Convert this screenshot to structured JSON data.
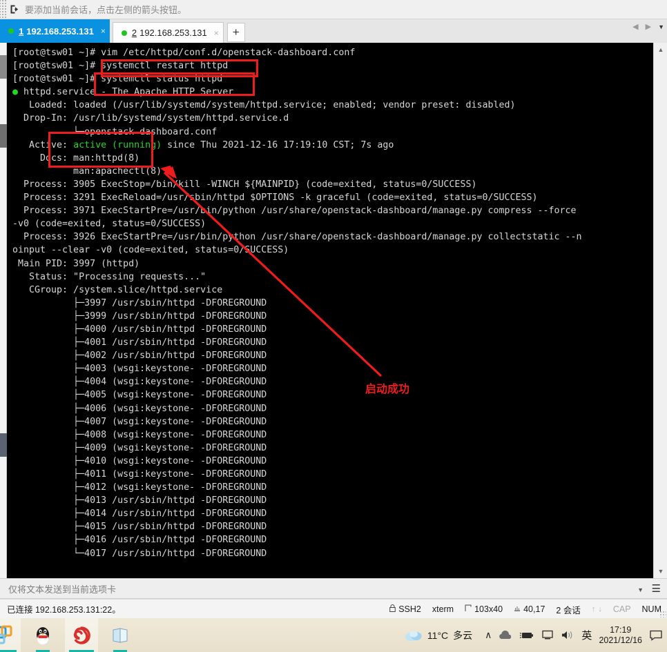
{
  "hint_bar": {
    "icon": "send-to-session-icon",
    "text": "要添加当前会话，点击左侧的箭头按钮。"
  },
  "tabs": {
    "items": [
      {
        "index": "1",
        "title": "192.168.253.131",
        "active": true,
        "status_dot": "#21c521",
        "close": "×"
      },
      {
        "index": "2",
        "title": "192.168.253.131",
        "active": false,
        "status_dot": "#21c521",
        "close": "×"
      }
    ],
    "new_tab_label": "+",
    "nav_prev": "◀",
    "nav_next": "▶",
    "nav_caret": "▼"
  },
  "terminal": {
    "lines": [
      "[root@tsw01 ~]# vim /etc/httpd/conf.d/openstack-dashboard.conf",
      "[root@tsw01 ~]# systemctl restart httpd",
      "[root@tsw01 ~]# systemctl status httpd",
      "DOT httpd.service - The Apache HTTP Server",
      "   Loaded: loaded (/usr/lib/systemd/system/httpd.service; enabled; vendor preset: disabled)",
      "  Drop-In: /usr/lib/systemd/system/httpd.service.d",
      "           └─openstack-dashboard.conf",
      "   Active: ACTIVE since Thu 2021-12-16 17:19:10 CST; 7s ago",
      "     Docs: man:httpd(8)",
      "           man:apachectl(8)",
      "  Process: 3905 ExecStop=/bin/kill -WINCH ${MAINPID} (code=exited, status=0/SUCCESS)",
      "  Process: 3291 ExecReload=/usr/sbin/httpd $OPTIONS -k graceful (code=exited, status=0/SUCCESS)",
      "  Process: 3971 ExecStartPre=/usr/bin/python /usr/share/openstack-dashboard/manage.py compress --force",
      "-v0 (code=exited, status=0/SUCCESS)",
      "  Process: 3926 ExecStartPre=/usr/bin/python /usr/share/openstack-dashboard/manage.py collectstatic --n",
      "oinput --clear -v0 (code=exited, status=0/SUCCESS)",
      " Main PID: 3997 (httpd)",
      "   Status: \"Processing requests...\"",
      "   CGroup: /system.slice/httpd.service",
      "           ├─3997 /usr/sbin/httpd -DFOREGROUND",
      "           ├─3999 /usr/sbin/httpd -DFOREGROUND",
      "           ├─4000 /usr/sbin/httpd -DFOREGROUND",
      "           ├─4001 /usr/sbin/httpd -DFOREGROUND",
      "           ├─4002 /usr/sbin/httpd -DFOREGROUND",
      "           ├─4003 (wsgi:keystone- -DFOREGROUND",
      "           ├─4004 (wsgi:keystone- -DFOREGROUND",
      "           ├─4005 (wsgi:keystone- -DFOREGROUND",
      "           ├─4006 (wsgi:keystone- -DFOREGROUND",
      "           ├─4007 (wsgi:keystone- -DFOREGROUND",
      "           ├─4008 (wsgi:keystone- -DFOREGROUND",
      "           ├─4009 (wsgi:keystone- -DFOREGROUND",
      "           ├─4010 (wsgi:keystone- -DFOREGROUND",
      "           ├─4011 (wsgi:keystone- -DFOREGROUND",
      "           ├─4012 (wsgi:keystone- -DFOREGROUND",
      "           ├─4013 /usr/sbin/httpd -DFOREGROUND",
      "           ├─4014 /usr/sbin/httpd -DFOREGROUND",
      "           ├─4015 /usr/sbin/httpd -DFOREGROUND",
      "           ├─4016 /usr/sbin/httpd -DFOREGROUND",
      "           └─4017 /usr/sbin/httpd -DFOREGROUND"
    ],
    "active_text": "active (running)",
    "service_dot": "●",
    "colors": {
      "background": "#000000",
      "foreground": "#d6d6d6",
      "green": "#25d425"
    }
  },
  "annotations": {
    "label": "启动成功",
    "color": "#ee1c1c",
    "boxes": [
      {
        "name": "systemctl restart httpd"
      },
      {
        "name": "systemctl status httpd"
      },
      {
        "name": "active (running) / Docs"
      }
    ]
  },
  "send_bar": {
    "text": "仅将文本发送到当前选项卡",
    "caret": "▼",
    "menu": "☰"
  },
  "status_bar": {
    "connection": "已连接 192.168.253.131:22。",
    "protocol": "SSH2",
    "protocol_icon": "lock-icon",
    "terminal_type": "xterm",
    "size": "103x40",
    "size_icon": "resize-icon",
    "cursor": "40,17",
    "cursor_icon": "cursor-icon",
    "sessions": "2 会话",
    "upload_arrow": "↑",
    "download_arrow": "↓",
    "cap": "CAP",
    "num": "NUM"
  },
  "taskbar": {
    "apps": [
      {
        "name": "vmware-icon",
        "open": true
      },
      {
        "name": "qq-icon",
        "open": false
      },
      {
        "name": "xshell-icon",
        "open": true
      },
      {
        "name": "notepad-icon",
        "open": false
      }
    ],
    "weather": {
      "temperature": "11°C",
      "condition": "多云",
      "icon": "cloud-icon"
    },
    "tray": {
      "chevron_up": "∧",
      "onedrive_icon": "cloud-filled-icon",
      "battery_icon": "battery-icon",
      "network_icon": "monitor-icon",
      "volume_icon": "speaker-icon",
      "ime": "英"
    },
    "clock": {
      "time": "17:19",
      "date": "2021/12/16"
    },
    "action_center_icon": "speech-bubble-icon"
  }
}
